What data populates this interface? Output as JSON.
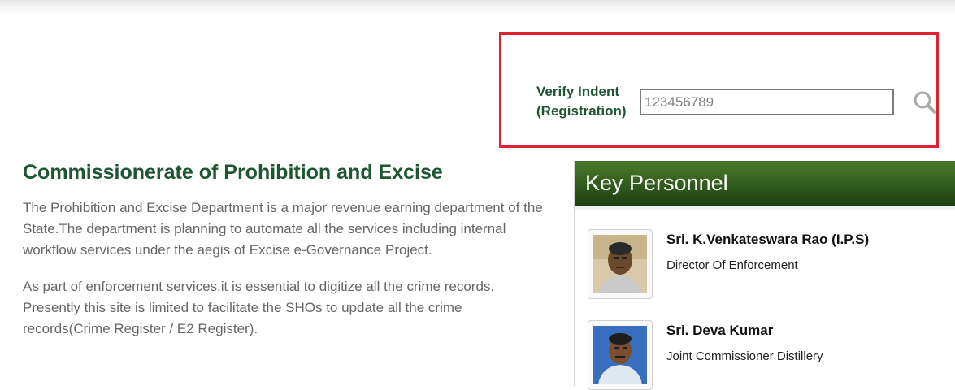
{
  "verify": {
    "label": "Verify Indent (Registration)",
    "input_value": "123456789",
    "search_icon": "search-icon"
  },
  "main": {
    "title": "Commissionerate of Prohibition and Excise",
    "paragraph1": "The Prohibition and Excise Department is a major revenue earning department of the State.The department is planning to automate all the services including internal workflow services under the aegis of Excise e-Governance Project.",
    "paragraph2": "As part of enforcement services,it is essential to digitize all the crime records. Presently this site is limited to facilitate the SHOs to update all the crime records(Crime Register / E2 Register)."
  },
  "key_personnel": {
    "header": "Key Personnel",
    "people": [
      {
        "name": "Sri. K.Venkateswara Rao (I.P.S)",
        "role": "Director Of Enforcement"
      },
      {
        "name": "Sri. Deva Kumar",
        "role": "Joint Commissioner Distillery"
      }
    ]
  },
  "colors": {
    "accent_green": "#1e5631",
    "highlight_red": "#e0212f",
    "header_green": "#2f5a1c"
  }
}
